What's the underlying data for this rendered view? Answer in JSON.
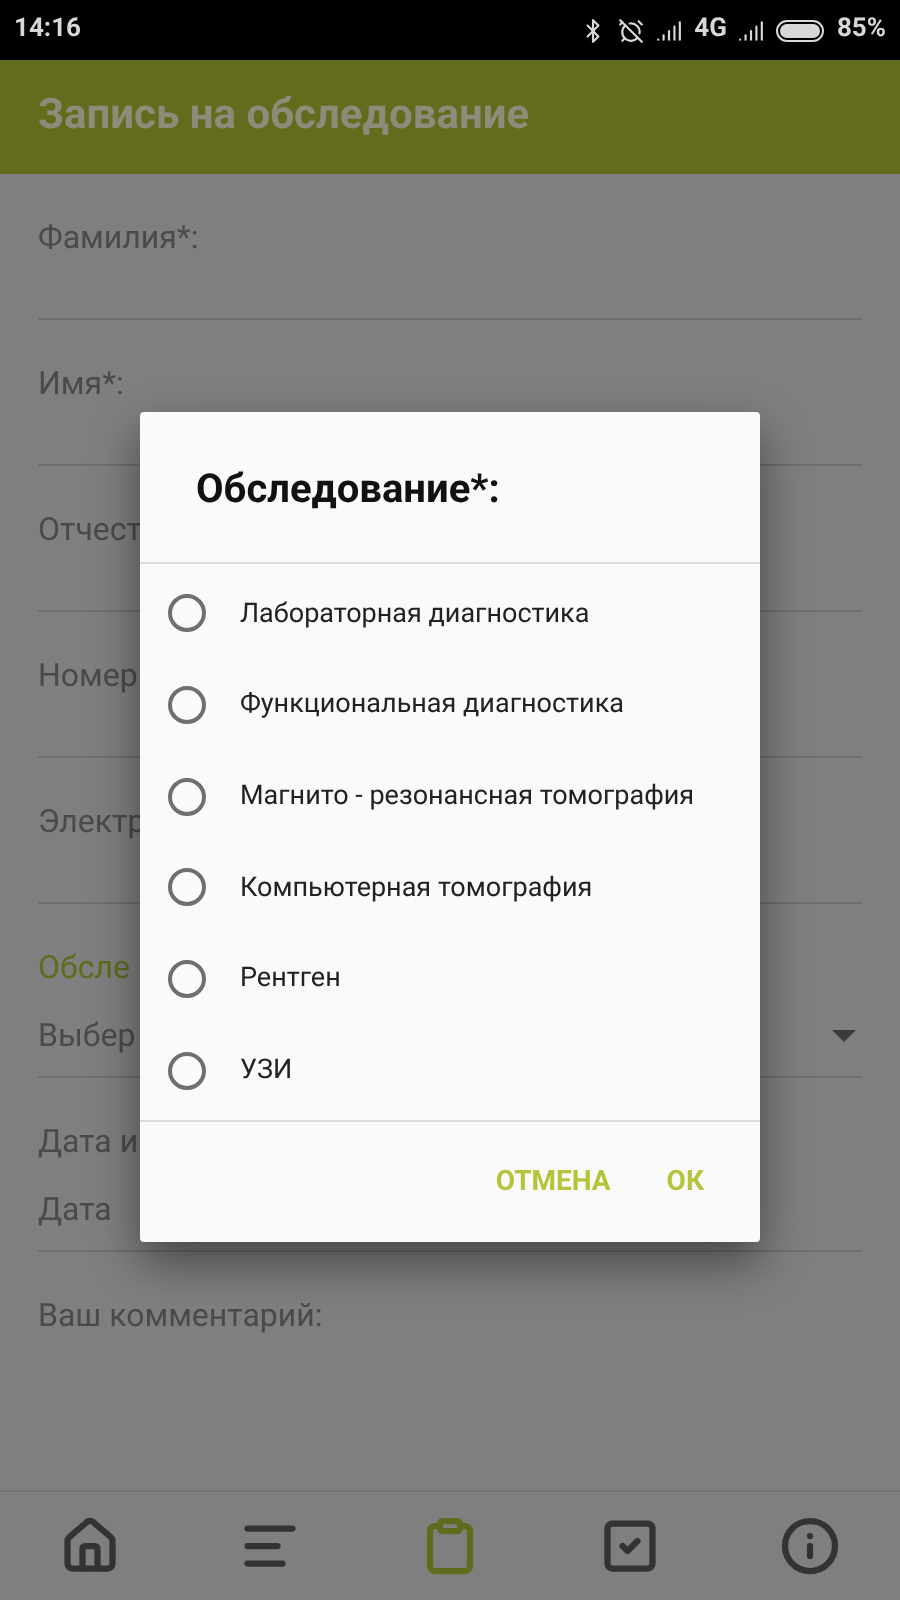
{
  "status_bar": {
    "time": "14:16",
    "network": "4G",
    "battery": "85%"
  },
  "app_bar": {
    "title": "Запись на обследование"
  },
  "form": [
    {
      "kind": "text",
      "label": "Фамилия*:"
    },
    {
      "kind": "text",
      "label": "Имя*:"
    },
    {
      "kind": "text",
      "label": "Отчест"
    },
    {
      "kind": "text",
      "label": "Номер"
    },
    {
      "kind": "text",
      "label": "Электр"
    },
    {
      "kind": "select",
      "label": "Обсле",
      "value": "Выбер"
    },
    {
      "kind": "text",
      "label": "Дата и",
      "value": "Дата"
    },
    {
      "kind": "text",
      "label": "Ваш комментарий:"
    }
  ],
  "dialog": {
    "title": "Обследование*:",
    "options": [
      {
        "label": "Лабораторная диагностика",
        "selected": false
      },
      {
        "label": "Функциональная диагностика",
        "selected": false
      },
      {
        "label": "Магнито - резонансная томография",
        "selected": false
      },
      {
        "label": "Компьютерная томография",
        "selected": false
      },
      {
        "label": "Рентген",
        "selected": false
      },
      {
        "label": "УЗИ",
        "selected": false
      }
    ],
    "buttons": [
      "ОТМЕНА",
      "ОК"
    ]
  },
  "bottom_nav": [
    {
      "kind": "home",
      "selected": false
    },
    {
      "kind": "list",
      "selected": false
    },
    {
      "kind": "clipboard",
      "selected": true
    },
    {
      "kind": "check",
      "selected": false
    },
    {
      "kind": "info",
      "selected": false
    }
  ]
}
